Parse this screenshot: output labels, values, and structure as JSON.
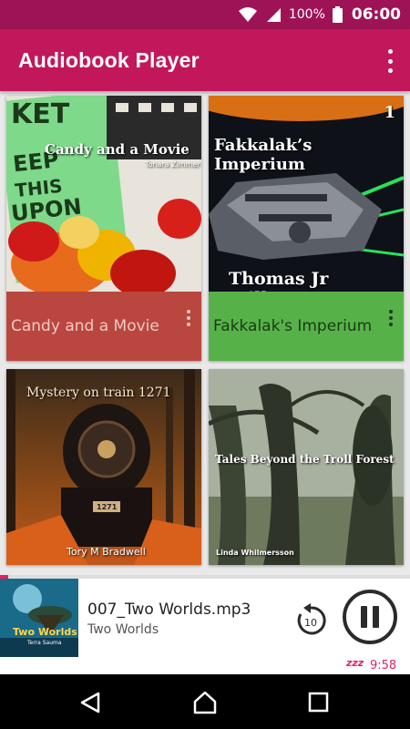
{
  "status": {
    "wifi_icon": "wifi-icon",
    "signal_icon": "signal-icon",
    "battery_percent": "100%",
    "battery_icon": "battery-icon",
    "time": "06:00"
  },
  "appbar": {
    "title": "Audiobook Player",
    "menu_icon": "overflow-menu-icon"
  },
  "books": [
    {
      "label": "Candy and a Movie",
      "cover_title": "Candy and a Movie",
      "cover_author": "Tonara Zimmer",
      "footer_color": "#b9473f",
      "label_color": "#f3c9c3"
    },
    {
      "label": "Fakkalak's Imperium",
      "cover_title": "Fakkalak’s Imperium",
      "cover_number": "1",
      "cover_author": "Thomas Jr Willson",
      "footer_color": "#56b248",
      "label_color": "#1b3a16"
    },
    {
      "label": "Mystery on train 1271",
      "cover_title": "Mystery on train 1271",
      "cover_author": "Tory M Bradwell",
      "cover_plate": "1271"
    },
    {
      "label": "Tales Beyond the Troll Forest",
      "cover_title": "Tales Beyond the Troll Forest",
      "cover_author": "Linda Whilmersson"
    }
  ],
  "player": {
    "progress": 0.02,
    "thumb_title": "Two Worlds",
    "thumb_author": "Terra Sauma",
    "track": "007_Two Worlds.mp3",
    "album": "Two Worlds",
    "rewind_seconds": "10",
    "sleep_icon": "zzz",
    "sleep_time": "9:58"
  },
  "nav": {
    "back_icon": "back-icon",
    "home_icon": "home-icon",
    "recents_icon": "recents-icon"
  }
}
